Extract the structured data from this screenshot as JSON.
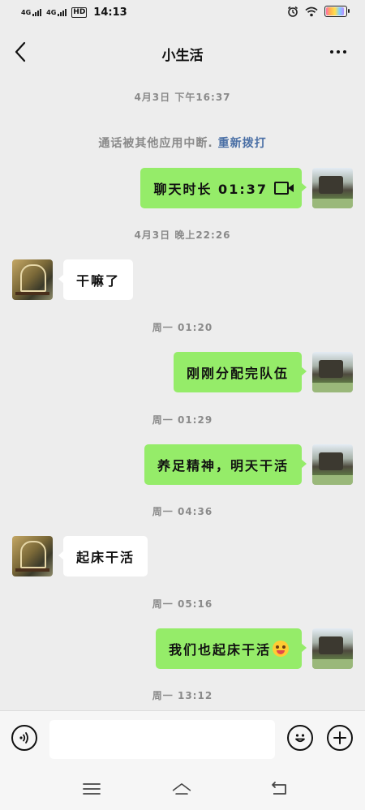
{
  "status_bar": {
    "signal1_label": "4G",
    "signal2_label": "4G",
    "hd_label": "HD",
    "time": "14:13",
    "battery_level": 0.85,
    "icons": [
      "signal-icon",
      "signal-icon",
      "hd-icon",
      "alarm-icon",
      "wifi-icon",
      "battery-icon"
    ]
  },
  "header": {
    "title": "小生活",
    "back_icon": "chevron-left-icon",
    "more_icon": "more-dots-icon"
  },
  "messages": [
    {
      "type": "timestamp",
      "text": "4月3日 下午16:37"
    },
    {
      "type": "system",
      "text": "通话被其他应用中断.",
      "link": "重新拨打"
    },
    {
      "type": "message",
      "from": "me",
      "text": "聊天时长 01:37",
      "icon": "video-call-icon"
    },
    {
      "type": "timestamp",
      "text": "4月3日 晚上22:26"
    },
    {
      "type": "message",
      "from": "them",
      "text": "干嘛了"
    },
    {
      "type": "timestamp",
      "text": "周一 01:20"
    },
    {
      "type": "message",
      "from": "me",
      "text": "刚刚分配完队伍"
    },
    {
      "type": "timestamp",
      "text": "周一 01:29"
    },
    {
      "type": "message",
      "from": "me",
      "text": "养足精神，明天干活"
    },
    {
      "type": "timestamp",
      "text": "周一 04:36"
    },
    {
      "type": "message",
      "from": "them",
      "text": "起床干活"
    },
    {
      "type": "timestamp",
      "text": "周一 05:16"
    },
    {
      "type": "message",
      "from": "me",
      "text": "我们也起床干活",
      "icon": "emoji-icon"
    },
    {
      "type": "timestamp",
      "text": "周一 13:12"
    }
  ],
  "input_bar": {
    "value": "",
    "placeholder": "",
    "icons": [
      "voice-icon",
      "emoji-icon",
      "plus-icon"
    ]
  },
  "nav_bar": {
    "icons": [
      "menu-icon",
      "home-icon",
      "back-icon"
    ]
  }
}
